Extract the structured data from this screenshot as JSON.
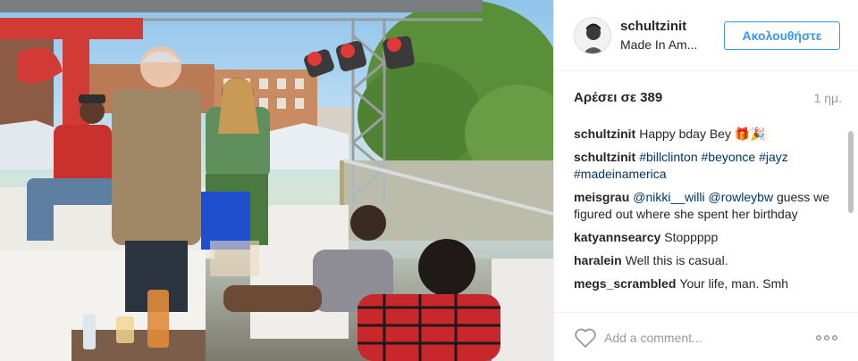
{
  "post": {
    "username": "schultzinit",
    "location": "Made In Am...",
    "follow_label": "Ακολουθήστε",
    "likes_text": "Αρέσει σε 389",
    "time_ago": "1 ημ.",
    "comment_placeholder": "Add a comment...",
    "accent_color": "#3897f0"
  },
  "comments": [
    {
      "user": "schultzinit",
      "text": "Happy bday Bey 🎁🎉"
    },
    {
      "user": "schultzinit",
      "tags": [
        "#billclinton",
        "#beyonce",
        "#jayz",
        "#madeinamerica"
      ]
    },
    {
      "user": "meisgrau",
      "mentions": [
        "@nikki__willi",
        "@rowleybw"
      ],
      "text": "guess we figured out where she spent her birthday"
    },
    {
      "user": "katyannsearcy",
      "text": "Stoppppp"
    },
    {
      "user": "haralein",
      "text": "Well this is casual."
    },
    {
      "user": "megs_scrambled",
      "text": "Your life, man. Smh"
    }
  ],
  "icons": {
    "like": "heart-icon",
    "more": "more-options-icon"
  }
}
